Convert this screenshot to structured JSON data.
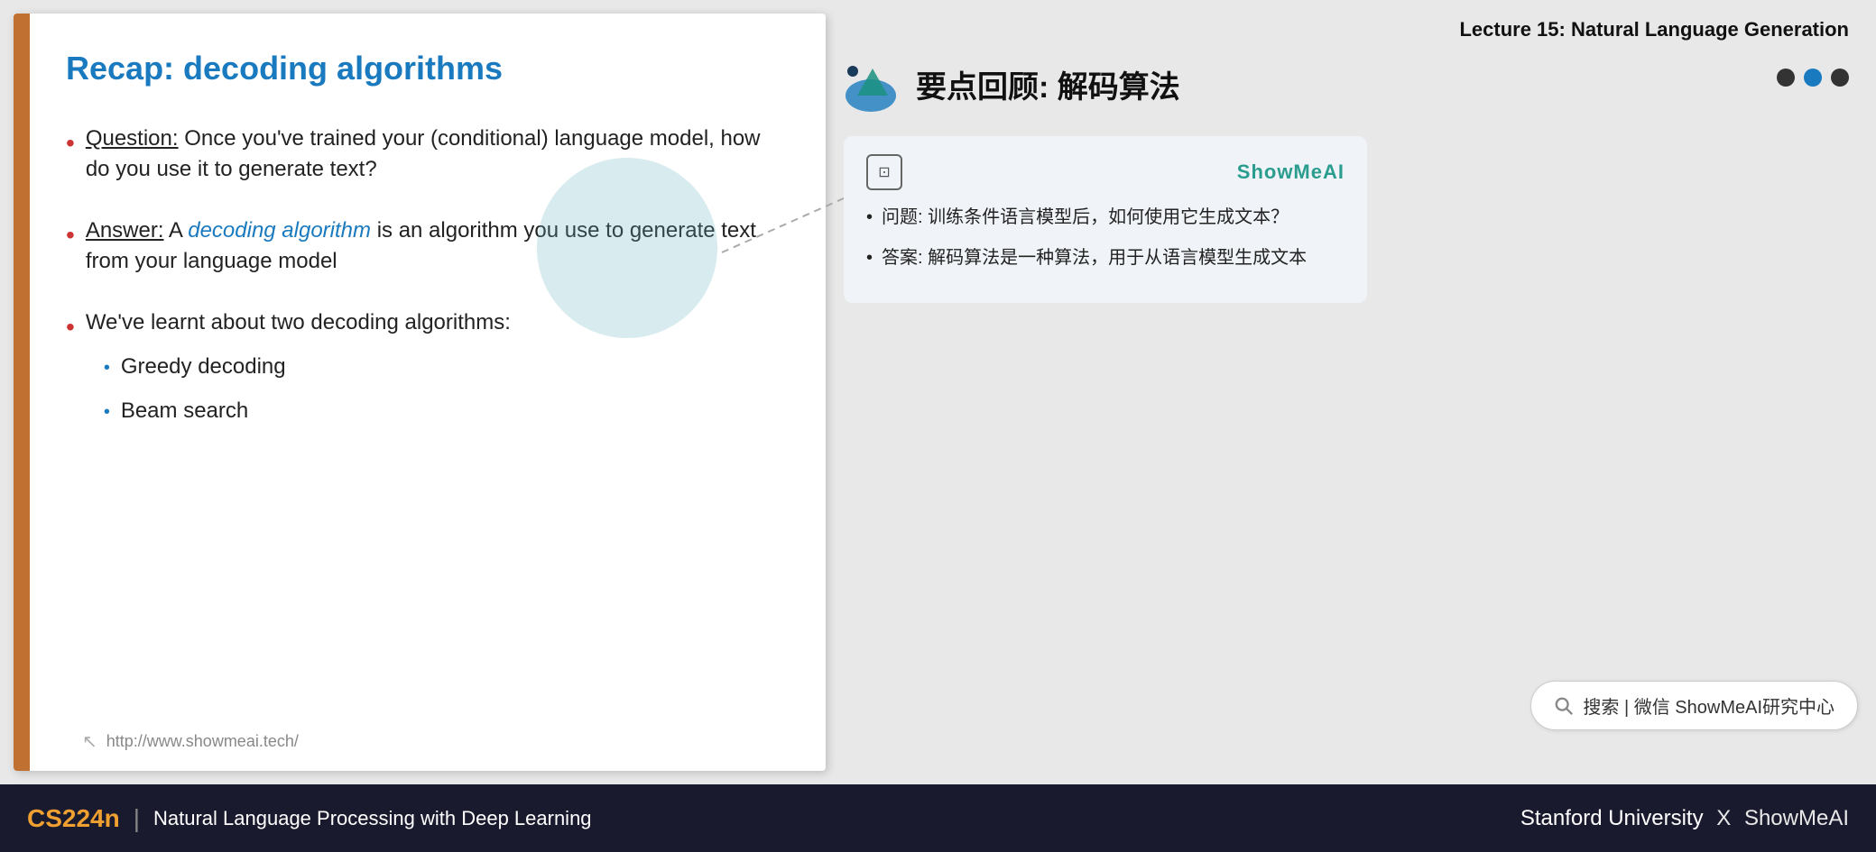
{
  "lecture": {
    "title": "Lecture 15: Natural Language Generation"
  },
  "slide": {
    "title": "Recap: decoding algorithms",
    "left_bar_color": "#c07030",
    "bullets": [
      {
        "id": "bullet-1",
        "label": "Question:",
        "text": " Once you've trained your (conditional) language model, how do you use it to generate text?"
      },
      {
        "id": "bullet-2",
        "label": "Answer:",
        "pre_italic": " A ",
        "italic_text": "decoding algorithm",
        "post_text": " is an algorithm you use to generate text from your language model"
      },
      {
        "id": "bullet-3",
        "text": "We've learnt about two decoding algorithms:",
        "sub_items": [
          "Greedy decoding",
          "Beam search"
        ]
      }
    ],
    "footer_url": "http://www.showmeai.tech/"
  },
  "chinese_panel": {
    "title": "要点回顾: 解码算法",
    "nav_dots": [
      "dark",
      "active",
      "dark"
    ],
    "card": {
      "brand": "ShowMeAI",
      "bullets": [
        "问题: 训练条件语言模型后，如何使用它生成文本？",
        "答案: 解码算法是一种算法，用于从语言模型生成文本"
      ]
    },
    "search_text": "搜索 | 微信  ShowMeAI研究中心"
  },
  "bottom_bar": {
    "course_code": "CS224n",
    "course_name": "Natural Language Processing with Deep Learning",
    "university": "Stanford University",
    "brand": "ShowMeAI"
  }
}
